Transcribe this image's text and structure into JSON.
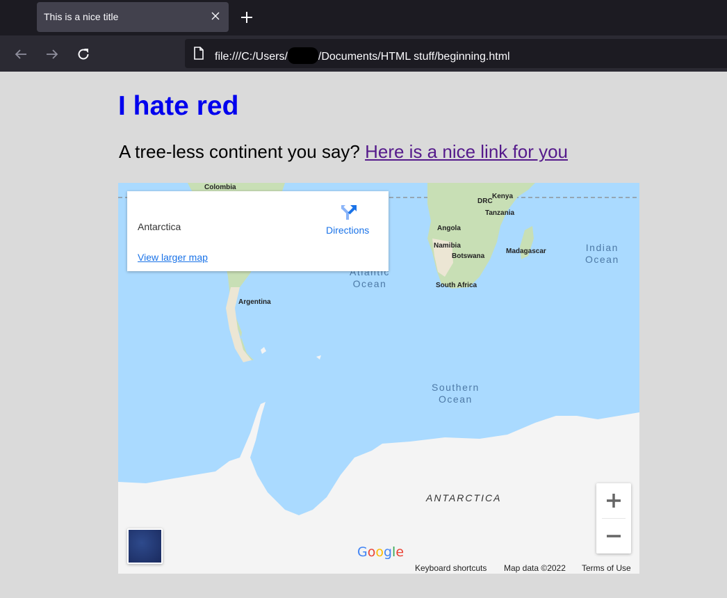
{
  "browser": {
    "tab_title": "This is a nice title",
    "url_prefix": "file:///C:/Users/",
    "url_suffix": "/Documents/HTML stuff/beginning.html"
  },
  "page": {
    "heading": "I hate red",
    "paragraph": "A tree-less continent you say? ",
    "link_text": "Here is a nice link for you"
  },
  "map": {
    "place_name": "Antarctica",
    "directions_label": "Directions",
    "view_larger_label": "View larger map",
    "labels": {
      "colombia": "Colombia",
      "drc": "DRC",
      "kenya": "Kenya",
      "tanzania": "Tanzania",
      "angola": "Angola",
      "namibia": "Namibia",
      "botswana": "Botswana",
      "madagascar": "Madagascar",
      "south_africa": "South Africa",
      "argentina": "Argentina"
    },
    "oceans": {
      "indian_1": "Indian",
      "indian_2": "Ocean",
      "atlantic_1": "Atlantic",
      "atlantic_2": "Ocean",
      "southern_1": "Southern",
      "southern_2": "Ocean"
    },
    "antarctica_label": "ANTARCTICA",
    "footer": {
      "keyboard_shortcuts": "Keyboard shortcuts",
      "map_data": "Map data ©2022",
      "terms": "Terms of Use"
    },
    "colors": {
      "water": "#aadaff",
      "land": "#f2efe9",
      "green": "#c8dfb5",
      "ice": "#f4f4f4"
    }
  }
}
